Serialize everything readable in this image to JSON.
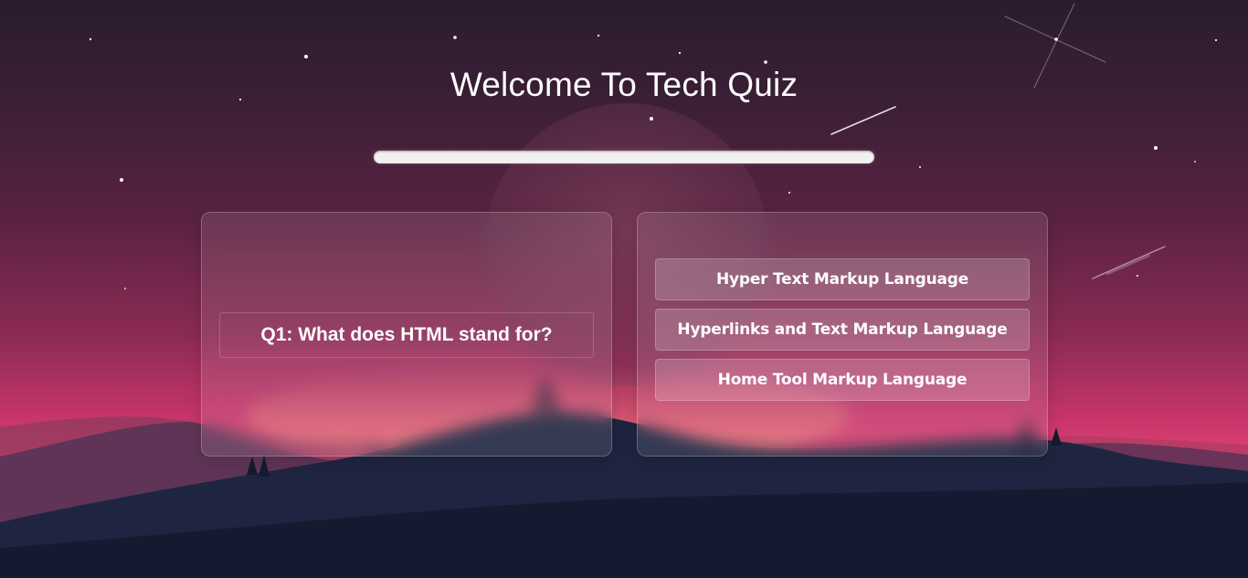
{
  "header": {
    "title": "Welcome To Tech Quiz"
  },
  "progress": {
    "value": 0
  },
  "question": {
    "text": "Q1: What does HTML stand for?"
  },
  "answers": [
    {
      "label": "Hyper Text Markup Language"
    },
    {
      "label": "Hyperlinks and Text Markup Language"
    },
    {
      "label": "Home Tool Markup Language"
    }
  ],
  "colors": {
    "sky_top": "#2a1c2d",
    "sky_mid": "#8b2b55",
    "horizon": "#e2426f",
    "ground": "#141b30",
    "text": "#ffffff"
  }
}
